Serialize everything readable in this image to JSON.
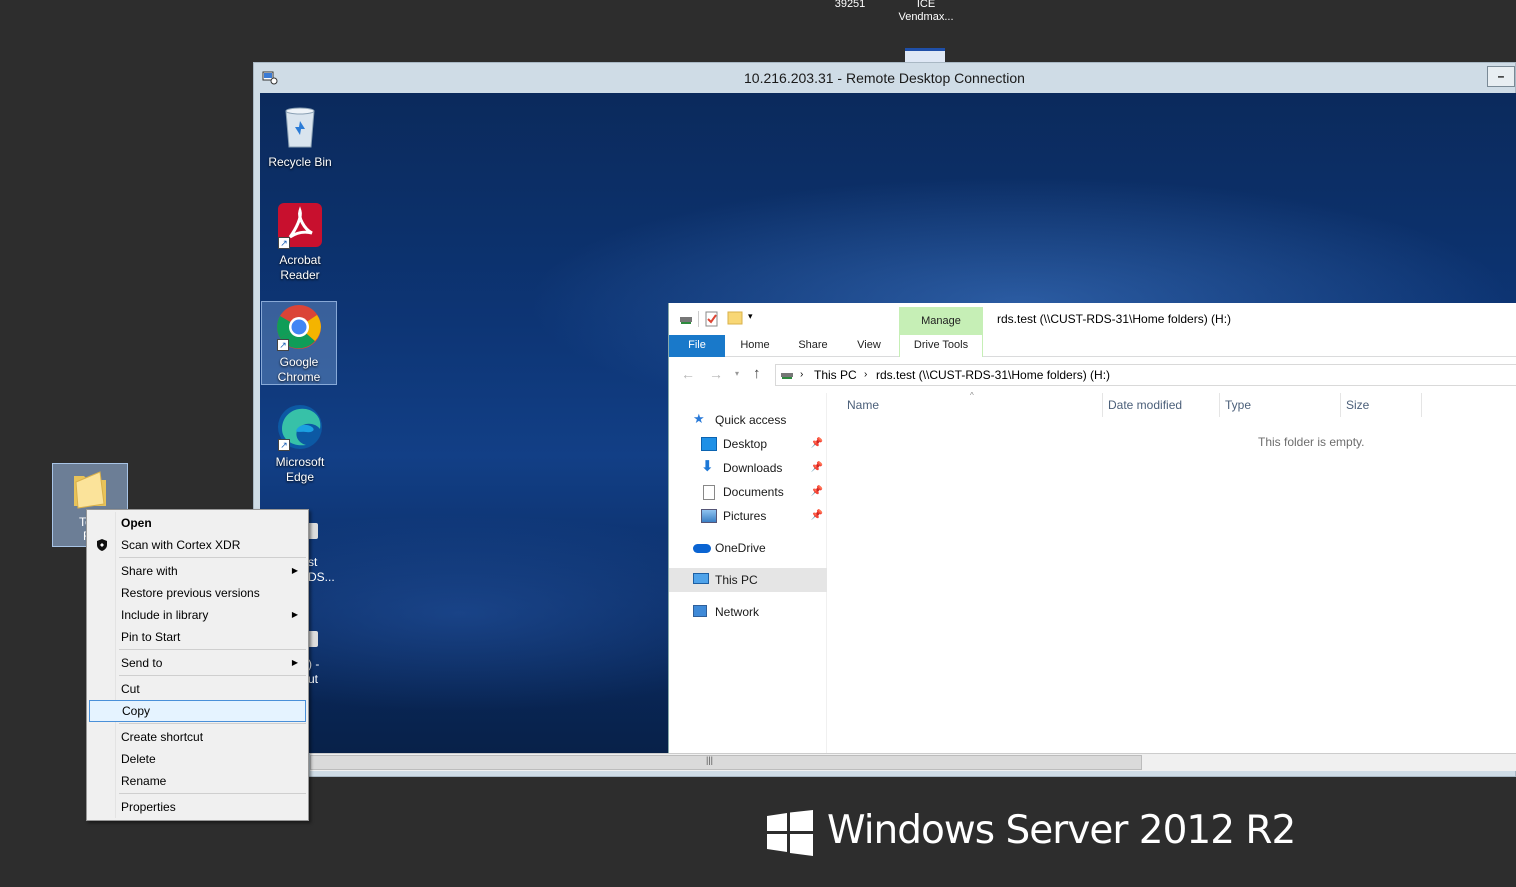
{
  "host_desktop": {
    "top_labels": [
      {
        "text": "39251"
      },
      {
        "text": "ICE"
      },
      {
        "text": "Vendmax..."
      }
    ],
    "folder_label_line1": "Test",
    "folder_label_line2": "Fo",
    "partial_labels": [
      "st",
      "DS...",
      ") -",
      "ut"
    ]
  },
  "rdp_window": {
    "title": "10.216.203.31 - Remote Desktop Connection",
    "minimize_glyph": "–"
  },
  "remote_desktop": {
    "icons": [
      {
        "label_line1": "Recycle Bin",
        "label_line2": ""
      },
      {
        "label_line1": "Acrobat",
        "label_line2": "Reader"
      },
      {
        "label_line1": "Google",
        "label_line2": "Chrome"
      },
      {
        "label_line1": "Microsoft",
        "label_line2": "Edge"
      }
    ]
  },
  "explorer": {
    "window_title": "rds.test (\\\\CUST-RDS-31\\Home folders) (H:)",
    "context_tab": "Manage",
    "tabs": [
      "File",
      "Home",
      "Share",
      "View",
      "Drive Tools"
    ],
    "breadcrumb": [
      "This PC",
      "rds.test (\\\\CUST-RDS-31\\Home folders) (H:)"
    ],
    "nav": {
      "quick_access": "Quick access",
      "desktop": "Desktop",
      "downloads": "Downloads",
      "documents": "Documents",
      "pictures": "Pictures",
      "onedrive": "OneDrive",
      "this_pc": "This PC",
      "network": "Network"
    },
    "columns": [
      "Name",
      "Date modified",
      "Type",
      "Size"
    ],
    "empty_message": "This folder is empty."
  },
  "context_menu": {
    "open": "Open",
    "scan": "Scan with Cortex XDR",
    "share_with": "Share with",
    "restore": "Restore previous versions",
    "include_library": "Include in library",
    "pin_start": "Pin to Start",
    "send_to": "Send to",
    "cut": "Cut",
    "copy": "Copy",
    "create_shortcut": "Create shortcut",
    "delete": "Delete",
    "rename": "Rename",
    "properties": "Properties",
    "highlighted": "Copy"
  },
  "branding": {
    "text": "Windows Server 2012 R2"
  },
  "colors": {
    "file_tab": "#1979ca",
    "manage_tab": "#c6efb6",
    "highlight": "#e5f3ff",
    "highlight_border": "#4a90d9"
  }
}
